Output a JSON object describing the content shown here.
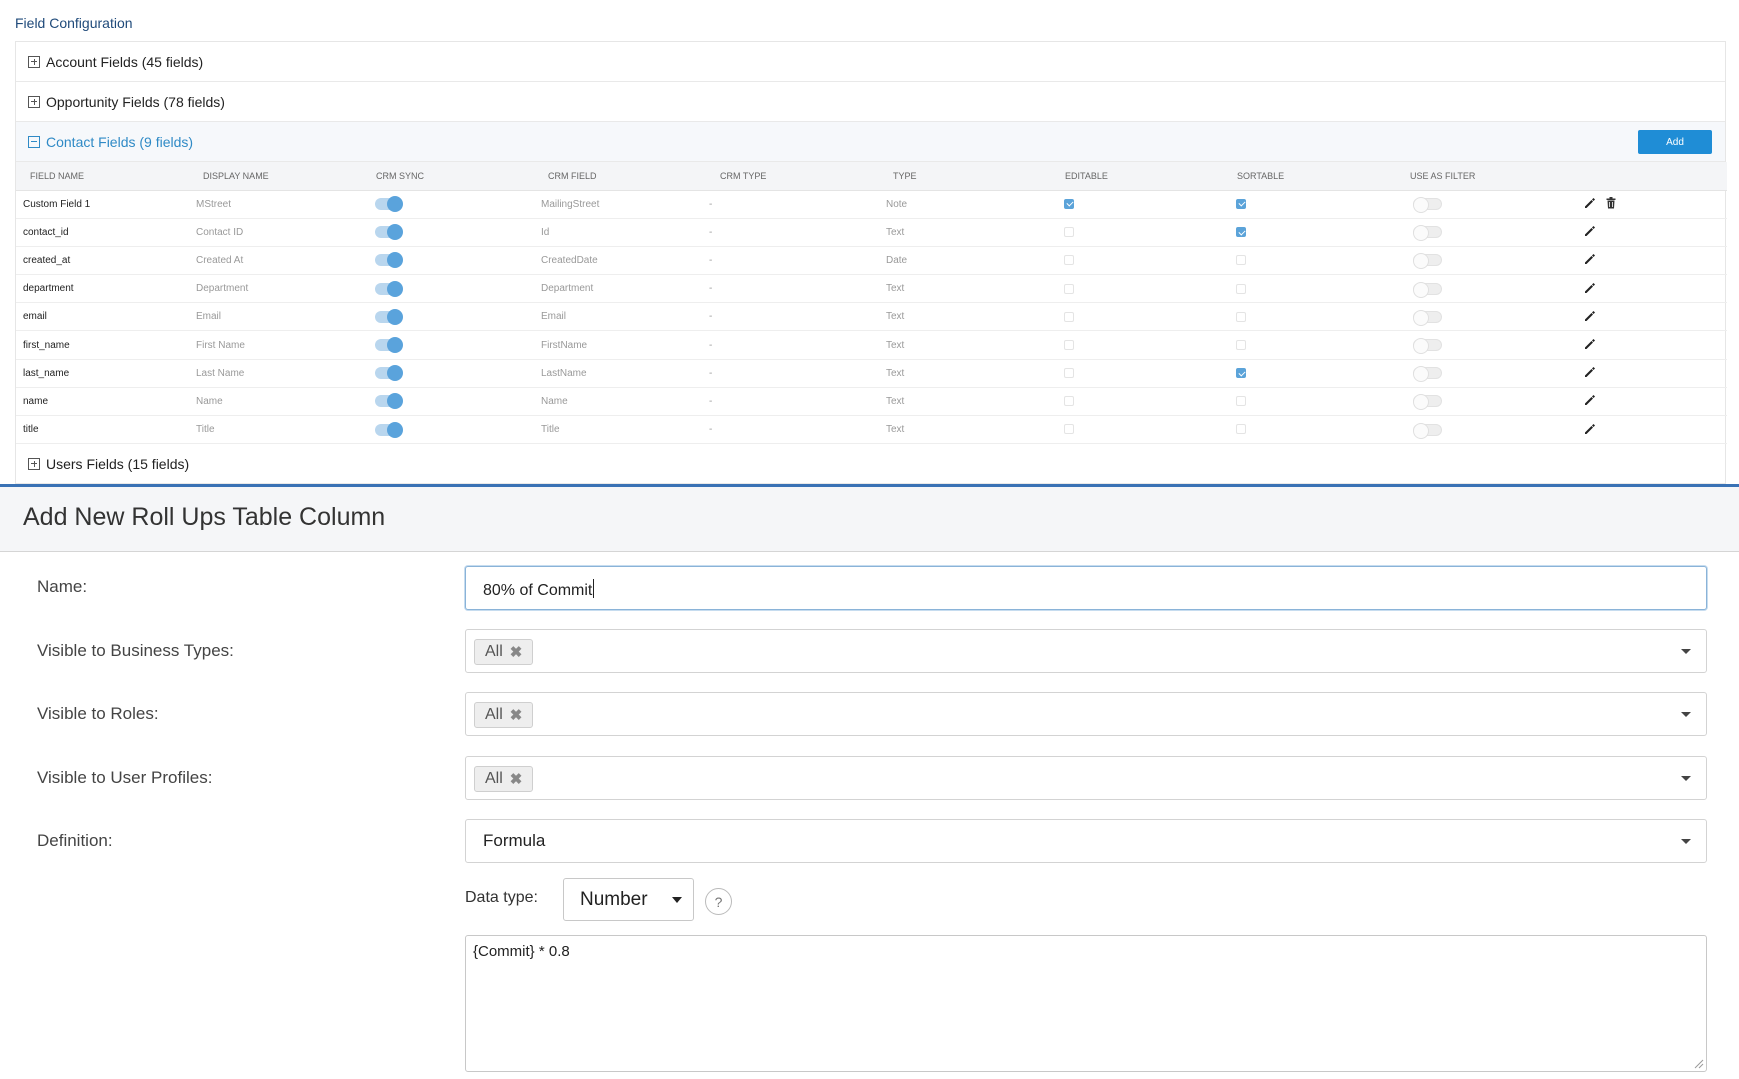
{
  "field_config": {
    "title": "Field Configuration",
    "sections": {
      "account": {
        "label": "Account Fields (45 fields)"
      },
      "opportunity": {
        "label": "Opportunity Fields (78 fields)"
      },
      "contact": {
        "label": "Contact Fields (9 fields)",
        "add_label": "Add"
      },
      "users": {
        "label": "Users Fields (15 fields)"
      }
    },
    "columns": [
      "FIELD NAME",
      "DISPLAY NAME",
      "CRM SYNC",
      "CRM FIELD",
      "CRM TYPE",
      "TYPE",
      "EDITABLE",
      "SORTABLE",
      "USE AS FILTER"
    ],
    "rows": [
      {
        "field_name": "Custom Field 1",
        "display_name": "MStreet",
        "crm_sync": true,
        "crm_field": "MailingStreet",
        "crm_type": "-",
        "type": "Note",
        "editable": true,
        "sortable": true,
        "use_as_filter": false,
        "deletable": true
      },
      {
        "field_name": "contact_id",
        "display_name": "Contact ID",
        "crm_sync": true,
        "crm_field": "Id",
        "crm_type": "-",
        "type": "Text",
        "editable": false,
        "sortable": true,
        "use_as_filter": false,
        "deletable": false
      },
      {
        "field_name": "created_at",
        "display_name": "Created At",
        "crm_sync": true,
        "crm_field": "CreatedDate",
        "crm_type": "-",
        "type": "Date",
        "editable": false,
        "sortable": false,
        "use_as_filter": false,
        "deletable": false
      },
      {
        "field_name": "department",
        "display_name": "Department",
        "crm_sync": true,
        "crm_field": "Department",
        "crm_type": "-",
        "type": "Text",
        "editable": false,
        "sortable": false,
        "use_as_filter": false,
        "deletable": false
      },
      {
        "field_name": "email",
        "display_name": "Email",
        "crm_sync": true,
        "crm_field": "Email",
        "crm_type": "-",
        "type": "Text",
        "editable": false,
        "sortable": false,
        "use_as_filter": false,
        "deletable": false
      },
      {
        "field_name": "first_name",
        "display_name": "First Name",
        "crm_sync": true,
        "crm_field": "FirstName",
        "crm_type": "-",
        "type": "Text",
        "editable": false,
        "sortable": false,
        "use_as_filter": false,
        "deletable": false
      },
      {
        "field_name": "last_name",
        "display_name": "Last Name",
        "crm_sync": true,
        "crm_field": "LastName",
        "crm_type": "-",
        "type": "Text",
        "editable": false,
        "sortable": true,
        "use_as_filter": false,
        "deletable": false
      },
      {
        "field_name": "name",
        "display_name": "Name",
        "crm_sync": true,
        "crm_field": "Name",
        "crm_type": "-",
        "type": "Text",
        "editable": false,
        "sortable": false,
        "use_as_filter": false,
        "deletable": false
      },
      {
        "field_name": "title",
        "display_name": "Title",
        "crm_sync": true,
        "crm_field": "Title",
        "crm_type": "-",
        "type": "Text",
        "editable": false,
        "sortable": false,
        "use_as_filter": false,
        "deletable": false
      }
    ],
    "icons": {
      "edit": "pencil-icon",
      "delete": "trash-icon"
    }
  },
  "form": {
    "title": "Add New Roll Ups Table Column",
    "name": {
      "label": "Name:",
      "value": "80% of Commit"
    },
    "business_types": {
      "label": "Visible to Business Types:",
      "tag": "All"
    },
    "roles": {
      "label": "Visible to Roles:",
      "tag": "All"
    },
    "user_profiles": {
      "label": "Visible to User Profiles:",
      "tag": "All"
    },
    "definition": {
      "label": "Definition:",
      "value": "Formula"
    },
    "data_type": {
      "label": "Data type:",
      "value": "Number",
      "help": "?"
    },
    "formula": {
      "value": "{Commit} * 0.8"
    },
    "tag_remove_glyph": "✖"
  },
  "colors": {
    "accent": "#1f8dd6",
    "toggle_on": "#5aa3dc",
    "header_rule": "#3a72b5",
    "link_blue": "#2f8ac6"
  }
}
